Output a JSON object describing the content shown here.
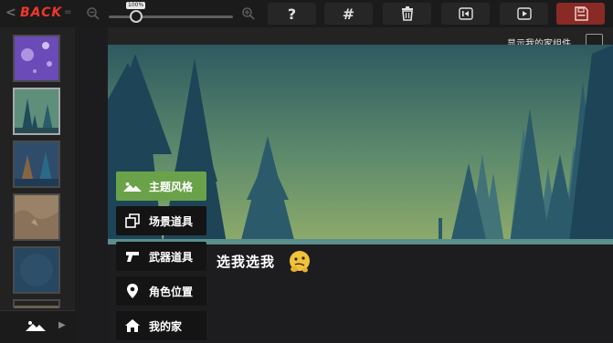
{
  "toolbar": {
    "back_label": "BACK",
    "zoom_value": "100%",
    "zoom_level": 0.22,
    "buttons": [
      {
        "icon": "help-icon",
        "glyph": "?"
      },
      {
        "icon": "grid-icon",
        "glyph": "#"
      },
      {
        "icon": "trash-icon"
      },
      {
        "icon": "skip-back-icon"
      },
      {
        "icon": "play-icon"
      },
      {
        "icon": "save-icon"
      }
    ]
  },
  "scene": {
    "show_components_label": "显示我的家组件"
  },
  "chat": {
    "message": "选我选我"
  },
  "menu": [
    {
      "label": "主题风格",
      "icon": "mountain-icon",
      "active": true
    },
    {
      "label": "场景道具",
      "icon": "copy-icon",
      "active": false
    },
    {
      "label": "武器道具",
      "icon": "gun-icon",
      "active": false
    },
    {
      "label": "角色位置",
      "icon": "location-pin-icon",
      "active": false
    },
    {
      "label": "我的家",
      "icon": "home-icon",
      "active": false
    }
  ],
  "thumbnails": [
    {
      "name": "purple-night-theme",
      "selected": false
    },
    {
      "name": "forest-theme",
      "selected": true
    },
    {
      "name": "blue-forest-theme",
      "selected": false
    },
    {
      "name": "desert-theme",
      "selected": false
    },
    {
      "name": "deep-blue-theme",
      "selected": false
    }
  ],
  "colors": {
    "accent_green": "#6aa24a",
    "back_red": "#e53a2e",
    "save_red": "#8a2a25"
  }
}
